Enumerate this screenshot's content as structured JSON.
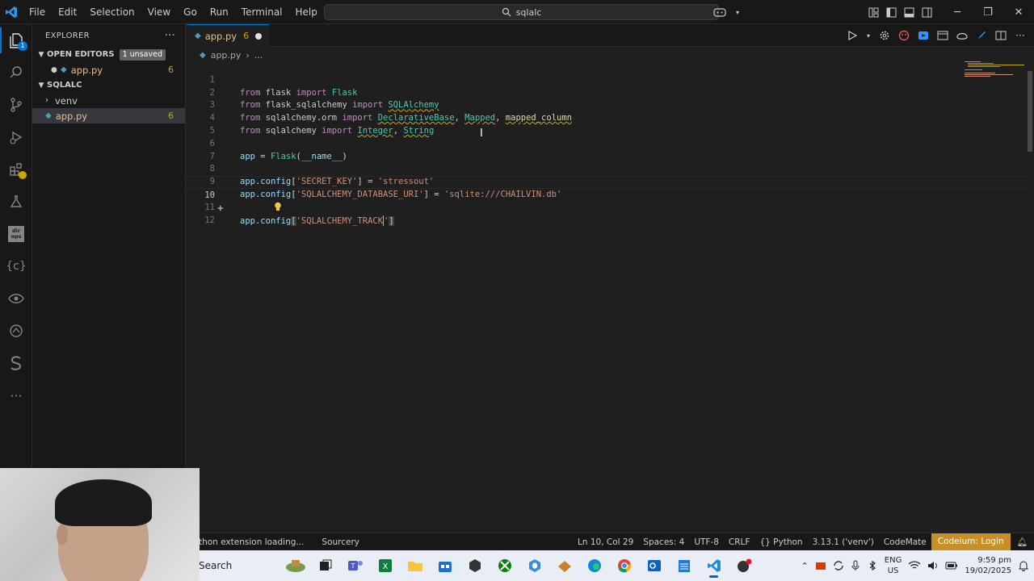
{
  "titlebar": {
    "menu": [
      "File",
      "Edit",
      "Selection",
      "View",
      "Go",
      "Run",
      "Terminal",
      "Help"
    ],
    "search_text": "sqlalc"
  },
  "sidebar": {
    "title": "EXPLORER",
    "more": "···",
    "open_editors_label": "OPEN EDITORS",
    "unsaved_badge": "1 unsaved",
    "open_file": {
      "name": "app.py",
      "count": "6"
    },
    "folder_label": "SQLALC",
    "items": [
      {
        "name": "venv"
      },
      {
        "name": "app.py",
        "count": "6"
      }
    ]
  },
  "editor": {
    "tab": {
      "name": "app.py",
      "count": "6"
    },
    "breadcrumb": [
      "app.py",
      "..."
    ],
    "line_numbers": [
      "1",
      "2",
      "3",
      "4",
      "5",
      "6",
      "7",
      "8",
      "9",
      "10",
      "11",
      "12"
    ],
    "current_line": "10",
    "code": {
      "l1": [
        "from",
        " flask ",
        "import",
        " Flask"
      ],
      "l2": [
        "from",
        " flask_sqlalchemy ",
        "import",
        " ",
        "SQLAlchemy"
      ],
      "l3": [
        "from",
        " sqlalchemy.orm ",
        "import",
        " ",
        "DeclarativeBase",
        ", ",
        "Mapped",
        ", ",
        "mapped_column"
      ],
      "l4": [
        "from",
        " sqlalchemy ",
        "import",
        " ",
        "Integer",
        ", ",
        "String"
      ],
      "l6": [
        "app",
        " = ",
        "Flask",
        "(",
        "__name__",
        ")"
      ],
      "l8": [
        "app",
        ".",
        "config",
        "[",
        "'SECRET_KEY'",
        "] = ",
        "'stressout'"
      ],
      "l9": [
        "app",
        ".",
        "config",
        "[",
        "'SQLALCHEMY_DATABASE_URI'",
        "] = ",
        "'sqlite:///CHAILVIN.db'"
      ],
      "l10": [
        "app",
        ".",
        "config",
        "[",
        "'SQLALCHEMY_TRACK",
        "'",
        "]"
      ]
    }
  },
  "statusbar": {
    "left": [
      "thon extension loading...",
      "Sourcery"
    ],
    "right": [
      "Ln 10, Col 29",
      "Spaces: 4",
      "UTF-8",
      "CRLF",
      "{} Python",
      "3.13.1 ('venv')",
      "CodeMate"
    ],
    "codeium": "Codeium: Login"
  },
  "taskbar": {
    "search_label": "Search",
    "lang_top": "ENG",
    "lang_bottom": "US",
    "time": "9:59 pm",
    "date": "19/02/2025"
  },
  "colors": {
    "accent": "#0078d4",
    "codeium": "#c69026",
    "warning": "#cca700"
  }
}
